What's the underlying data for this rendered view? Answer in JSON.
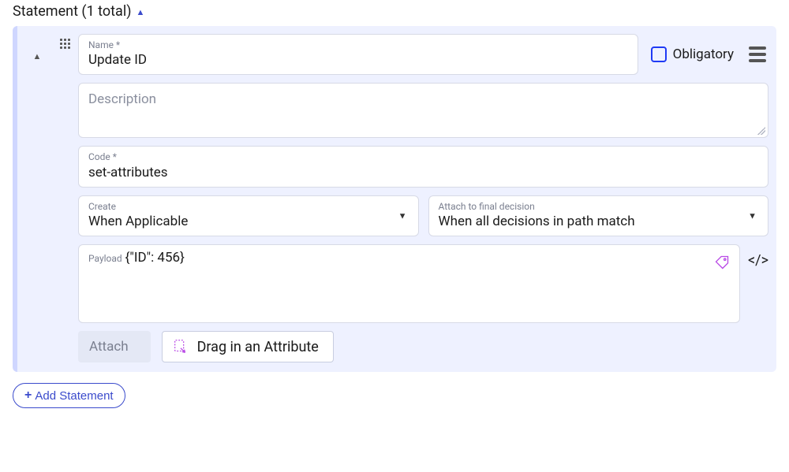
{
  "header": {
    "title": "Statement (1 total)"
  },
  "statement": {
    "name_label": "Name *",
    "name_value": "Update ID",
    "obligatory_label": "Obligatory",
    "description_placeholder": "Description",
    "code_label": "Code *",
    "code_value": "set-attributes",
    "create": {
      "label": "Create",
      "value": "When Applicable"
    },
    "attach_final": {
      "label": "Attach to final decision",
      "value": "When all decisions in path match"
    },
    "payload": {
      "label": "Payload",
      "value": "{\"ID\": 456}"
    },
    "attach_chip": "Attach",
    "drag_attr": "Drag in an Attribute"
  },
  "footer": {
    "add_statement": "Add Statement"
  }
}
